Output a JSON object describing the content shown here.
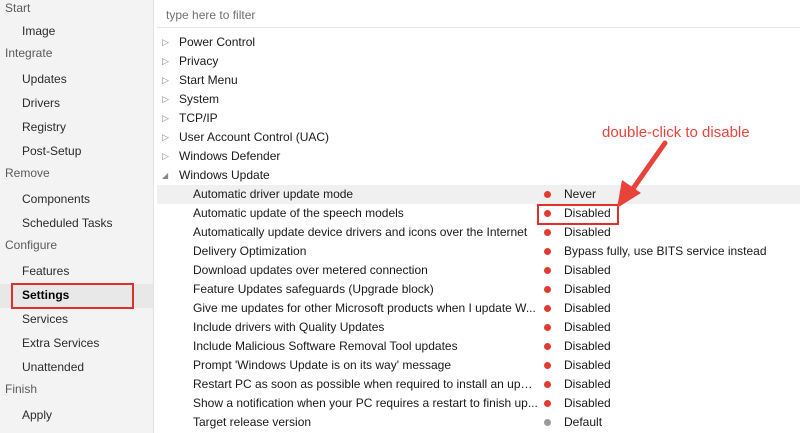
{
  "sidebar": {
    "sections": [
      {
        "label": "Start",
        "items": [
          {
            "label": "Image"
          }
        ]
      },
      {
        "label": "Integrate",
        "items": [
          {
            "label": "Updates"
          },
          {
            "label": "Drivers"
          },
          {
            "label": "Registry"
          },
          {
            "label": "Post-Setup"
          }
        ]
      },
      {
        "label": "Remove",
        "items": [
          {
            "label": "Components"
          },
          {
            "label": "Scheduled Tasks"
          }
        ]
      },
      {
        "label": "Configure",
        "items": [
          {
            "label": "Features"
          },
          {
            "label": "Settings",
            "selected": true
          },
          {
            "label": "Services"
          },
          {
            "label": "Extra Services"
          },
          {
            "label": "Unattended"
          }
        ]
      },
      {
        "label": "Finish",
        "items": [
          {
            "label": "Apply"
          }
        ]
      }
    ]
  },
  "filter": {
    "placeholder": "type here to filter"
  },
  "tree": {
    "collapsed": [
      "Power Control",
      "Privacy",
      "Start Menu",
      "System",
      "TCP/IP",
      "User Account Control (UAC)",
      "Windows Defender"
    ],
    "expanded": {
      "label": "Windows Update",
      "settings": [
        {
          "name": "Automatic driver update mode",
          "value": "Never",
          "status": "red"
        },
        {
          "name": "Automatic update of the speech models",
          "value": "Disabled",
          "status": "red"
        },
        {
          "name": "Automatically update device drivers and icons over the Internet",
          "value": "Disabled",
          "status": "red"
        },
        {
          "name": "Delivery Optimization",
          "value": "Bypass fully, use BITS service instead",
          "status": "red"
        },
        {
          "name": "Download updates over metered connection",
          "value": "Disabled",
          "status": "red"
        },
        {
          "name": "Feature Updates safeguards (Upgrade block)",
          "value": "Disabled",
          "status": "red"
        },
        {
          "name": "Give me updates for other Microsoft products when I update W...",
          "value": "Disabled",
          "status": "red"
        },
        {
          "name": "Include drivers with Quality Updates",
          "value": "Disabled",
          "status": "red"
        },
        {
          "name": "Include Malicious Software Removal Tool updates",
          "value": "Disabled",
          "status": "red"
        },
        {
          "name": "Prompt 'Windows Update is on its way' message",
          "value": "Disabled",
          "status": "red"
        },
        {
          "name": "Restart PC as soon as possible when required to install an update",
          "value": "Disabled",
          "status": "red"
        },
        {
          "name": "Show a notification when your PC requires a restart to finish up...",
          "value": "Disabled",
          "status": "red"
        },
        {
          "name": "Target release version",
          "value": "Default",
          "status": "gray"
        }
      ]
    }
  },
  "annotation": {
    "text": "double-click to disable"
  },
  "colors": {
    "accent_red": "#e0302a",
    "status_red": "#e13b30",
    "status_gray": "#9a9a9a",
    "annotation": "#e8433b"
  }
}
